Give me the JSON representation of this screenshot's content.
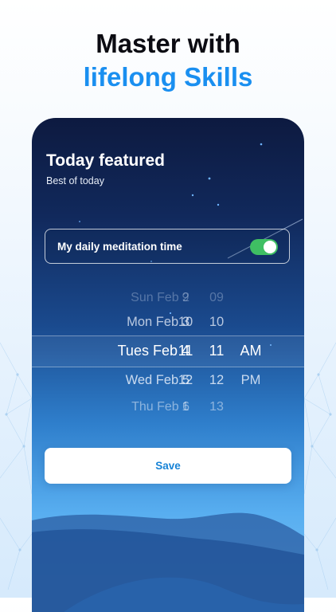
{
  "headline": {
    "line1": "Master with",
    "line2": "lifelong Skills"
  },
  "card": {
    "title": "Today featured",
    "subtitle": "Best of today"
  },
  "toggle": {
    "label": "My daily meditation time",
    "on": true
  },
  "picker": {
    "rows": [
      {
        "date": "Sun Feb 2",
        "hour": "9",
        "minute": "09",
        "ampm": ""
      },
      {
        "date": "Mon Feb 3",
        "hour": "10",
        "minute": "10",
        "ampm": ""
      },
      {
        "date": "Tues Feb 4",
        "hour": "11",
        "minute": "11",
        "ampm": "AM"
      },
      {
        "date": "Wed Feb 5",
        "hour": "12",
        "minute": "12",
        "ampm": "PM"
      },
      {
        "date": "Thu Feb 6",
        "hour": "1",
        "minute": "13",
        "ampm": ""
      }
    ],
    "selected_index": 2
  },
  "save_label": "Save",
  "colors": {
    "accent": "#1a8ff0",
    "toggle_on": "#3fbf63",
    "card_dark": "#0d1a40"
  }
}
